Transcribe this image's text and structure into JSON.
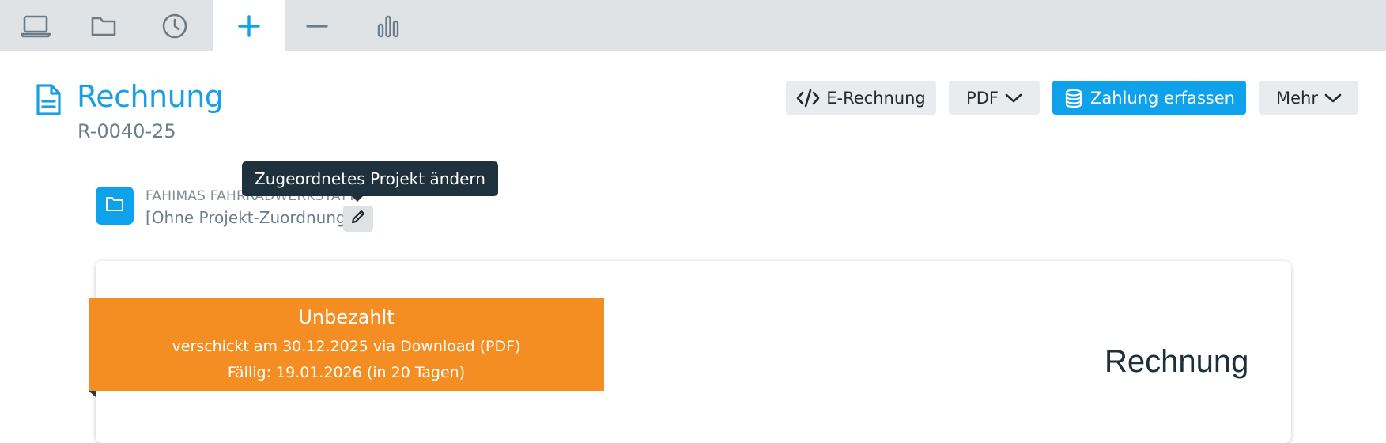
{
  "colors": {
    "accent": "#0ea2ea",
    "title_blue": "#1a9fe0",
    "status_unpaid": "#f58e22",
    "tabbar_bg": "#dfe3e6",
    "tooltip_bg": "#1e313d"
  },
  "tabs": [
    {
      "icon": "laptop-icon",
      "active": false
    },
    {
      "icon": "folder-icon",
      "active": false
    },
    {
      "icon": "clock-icon",
      "active": false
    },
    {
      "icon": "plus-icon",
      "active": true
    },
    {
      "icon": "minus-icon",
      "active": false
    },
    {
      "icon": "bar-chart-icon",
      "active": false
    }
  ],
  "header": {
    "title": "Rechnung",
    "number": "R-0040-25"
  },
  "toolbar": {
    "e_invoice_label": "E-Rechnung",
    "pdf_label": "PDF",
    "payment_label": "Zahlung erfassen",
    "more_label": "Mehr"
  },
  "project": {
    "client_name": "FAHIMAS FAHRRADWERKSTATT",
    "project_label": "[Ohne Projekt-Zuordnung]",
    "tooltip": "Zugeordnetes Projekt ändern"
  },
  "status": {
    "title": "Unbezahlt",
    "sent_info": "verschickt am 30.12.2025 via Download (PDF)",
    "due_info": "Fällig: 19.01.2026 (in 20 Tagen)"
  },
  "document": {
    "heading": "Rechnung"
  }
}
